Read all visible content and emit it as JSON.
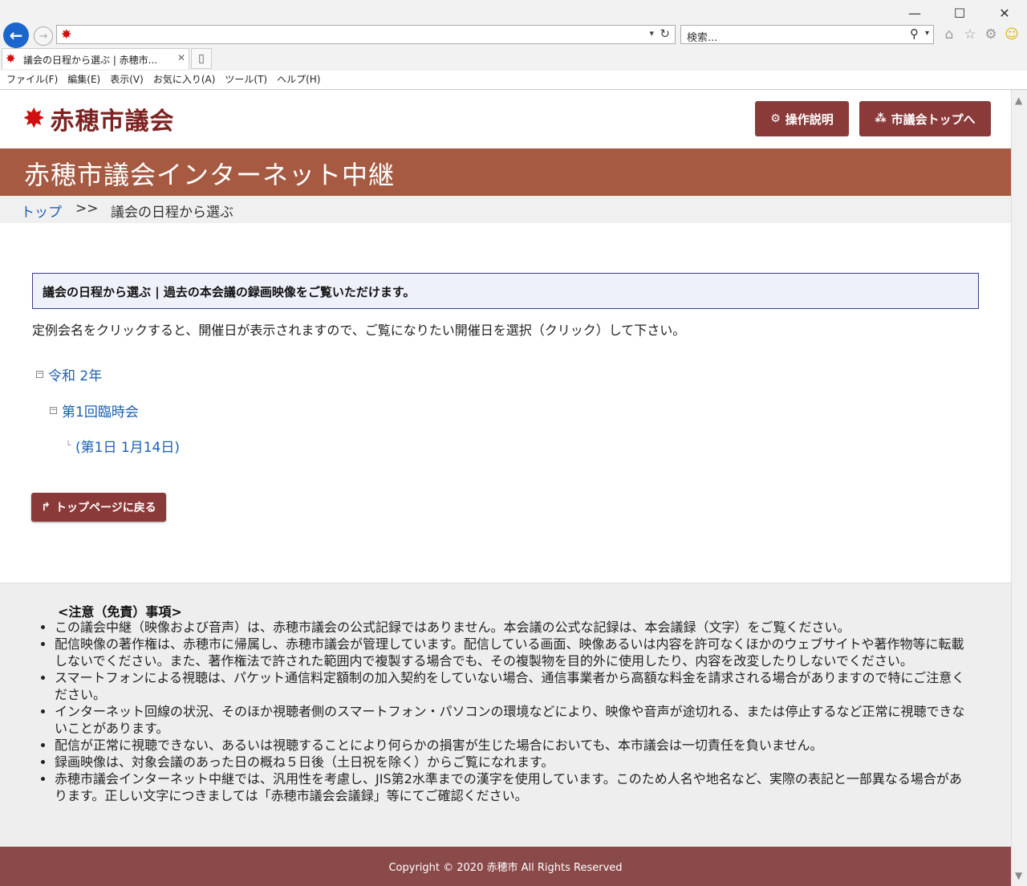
{
  "browser": {
    "window_controls": {
      "minimize": "—",
      "maximize": "☐",
      "close": "✕"
    },
    "search_placeholder": "検索...",
    "tab_title": "議会の日程から選ぶ | 赤穂市...",
    "menu": [
      "ファイル(F)",
      "編集(E)",
      "表示(V)",
      "お気に入り(A)",
      "ツール(T)",
      "ヘルプ(H)"
    ]
  },
  "header": {
    "site_name": "赤穂市議会",
    "help_button": "操作説明",
    "top_button": "市議会トップへ",
    "banner_title": "赤穂市議会インターネット中継"
  },
  "breadcrumb": {
    "home": "トップ",
    "separator": ">>",
    "current": "議会の日程から選ぶ"
  },
  "main": {
    "notice": "議会の日程から選ぶ | 過去の本会議の録画映像をご覧いただけます。",
    "instruction": "定例会名をクリックすると、開催日が表示されますので、ご覧になりたい開催日を選択（クリック）して下さい。",
    "tree": {
      "year": "令和 2年",
      "session": "第1回臨時会",
      "day": "(第1日 1月14日)"
    },
    "back_button": "トップページに戻る"
  },
  "notes": {
    "heading": "<注意（免責）事項>",
    "items": [
      "この議会中継（映像および音声）は、赤穂市議会の公式記録ではありません。本会議の公式な記録は、本会議録（文字）をご覧ください。",
      "配信映像の著作権は、赤穂市に帰属し、赤穂市議会が管理しています。配信している画面、映像あるいは内容を許可なくほかのウェブサイトや著作物等に転載しないでください。また、著作権法で許された範囲内で複製する場合でも、その複製物を目的外に使用したり、内容を改変したりしないでください。",
      "スマートフォンによる視聴は、パケット通信料定額制の加入契約をしていない場合、通信事業者から高額な料金を請求される場合がありますので特にご注意ください。",
      "インターネット回線の状況、そのほか視聴者側のスマートフォン・パソコンの環境などにより、映像や音声が途切れる、または停止するなど正常に視聴できないことがあります。",
      "配信が正常に視聴できない、あるいは視聴することにより何らかの損害が生じた場合においても、本市議会は一切責任を負いません。",
      "録画映像は、対象会議のあった日の概ね５日後（土日祝を除く）からご覧になれます。",
      "赤穂市議会インターネット中継では、汎用性を考慮し、JIS第2水準までの漢字を使用しています。このため人名や地名など、実際の表記と一部異なる場合があります。正しい文字につきましては「赤穂市議会会議録」等にてご確認ください。"
    ]
  },
  "footer": {
    "copyright": "Copyright © 2020 赤穂市 All Rights Reserved"
  },
  "colors": {
    "brand": "#8b3a3a",
    "banner": "#a65a42",
    "link": "#1a5fb4"
  }
}
